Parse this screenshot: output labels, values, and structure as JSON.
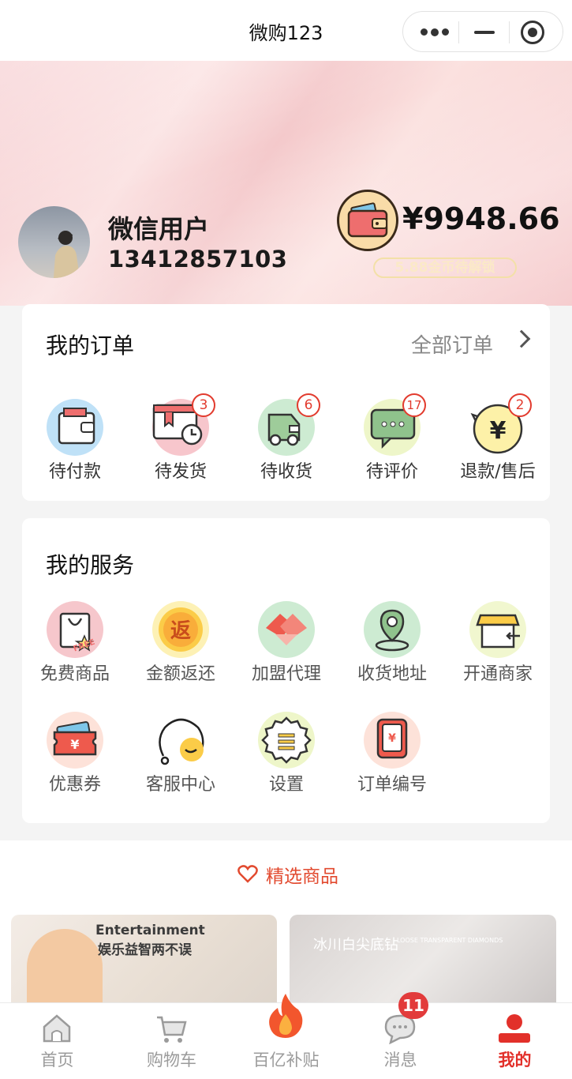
{
  "navbar": {
    "title": "微购123"
  },
  "profile": {
    "username": "微信用户",
    "phone": "13412857103",
    "balance": "¥9948.66",
    "coins": "5.88金币待解锁"
  },
  "orders": {
    "title": "我的订单",
    "all_label": "全部订单",
    "items": [
      {
        "label": "待付款",
        "badge": ""
      },
      {
        "label": "待发货",
        "badge": "3"
      },
      {
        "label": "待收货",
        "badge": "6"
      },
      {
        "label": "待评价",
        "badge": "17"
      },
      {
        "label": "退款/售后",
        "badge": "2"
      }
    ]
  },
  "services": {
    "title": "我的服务",
    "items": [
      {
        "label": "免费商品"
      },
      {
        "label": "金额返还",
        "glyph": "返"
      },
      {
        "label": "加盟代理"
      },
      {
        "label": "收货地址"
      },
      {
        "label": "开通商家"
      },
      {
        "label": "优惠券",
        "glyph": "¥"
      },
      {
        "label": "客服中心"
      },
      {
        "label": "设置"
      },
      {
        "label": "订单编号",
        "glyph": "¥"
      }
    ]
  },
  "featured": {
    "label": "精选商品"
  },
  "products": [
    {
      "line1": "Entertainment",
      "line2": "娱乐益智两不误"
    },
    {
      "line1": "冰川白尖底钻",
      "line1_small": "LOOSE TRANSPARENT DIAMONDS"
    }
  ],
  "tabbar": {
    "tabs": [
      {
        "label": "首页"
      },
      {
        "label": "购物车"
      },
      {
        "label": "百亿补贴"
      },
      {
        "label": "消息"
      },
      {
        "label": "我的"
      }
    ],
    "message_badge": "11"
  },
  "colors": {
    "accent": "#e2302a",
    "badge": "#e23b2e"
  }
}
